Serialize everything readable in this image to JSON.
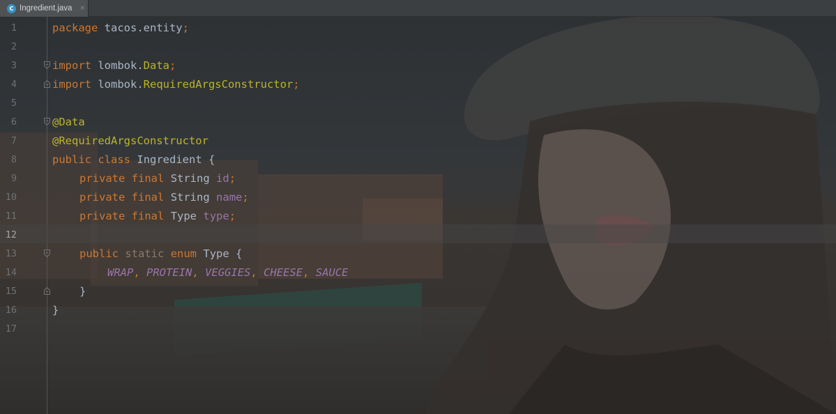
{
  "tab": {
    "icon": "java-class-icon",
    "icon_letter": "C",
    "label": "Ingredient.java",
    "close": "×"
  },
  "gutter": {
    "line_numbers": [
      "1",
      "2",
      "3",
      "4",
      "5",
      "6",
      "7",
      "8",
      "9",
      "10",
      "11",
      "12",
      "13",
      "14",
      "15",
      "16",
      "17"
    ],
    "current_line": "12"
  },
  "code": {
    "l1": {
      "kw": "package",
      "pkg": " tacos.entity",
      "semi": ";"
    },
    "l3": {
      "kw": "import",
      "pkg": " lombok.",
      "cls": "Data",
      "semi": ";"
    },
    "l4": {
      "kw": "import",
      "pkg": " lombok.",
      "cls": "RequiredArgsConstructor",
      "semi": ";"
    },
    "l6": {
      "ann": "@Data"
    },
    "l7": {
      "ann": "@RequiredArgsConstructor"
    },
    "l8": {
      "kw1": "public",
      "kw2": "class",
      "name": "Ingredient",
      "brace": "{"
    },
    "l9": {
      "kw1": "private",
      "kw2": "final",
      "type": "String",
      "field": "id",
      "semi": ";"
    },
    "l10": {
      "kw1": "private",
      "kw2": "final",
      "type": "String",
      "field": "name",
      "semi": ";"
    },
    "l11": {
      "kw1": "private",
      "kw2": "final",
      "type": "Type",
      "field": "type",
      "semi": ";"
    },
    "l13": {
      "kw1": "public",
      "kw2": "static",
      "kw3": "enum",
      "name": "Type",
      "brace": "{"
    },
    "l14": {
      "constants": [
        "WRAP",
        "PROTEIN",
        "VEGGIES",
        "CHEESE",
        "SAUCE"
      ],
      "sep": ","
    },
    "l15": {
      "brace": "}"
    },
    "l16": {
      "brace": "}"
    }
  },
  "colors": {
    "keyword": "#cc7832",
    "text": "#a9b7c6",
    "annotation": "#bbb529",
    "field": "#9876aa",
    "background": "#2b2b2b"
  }
}
